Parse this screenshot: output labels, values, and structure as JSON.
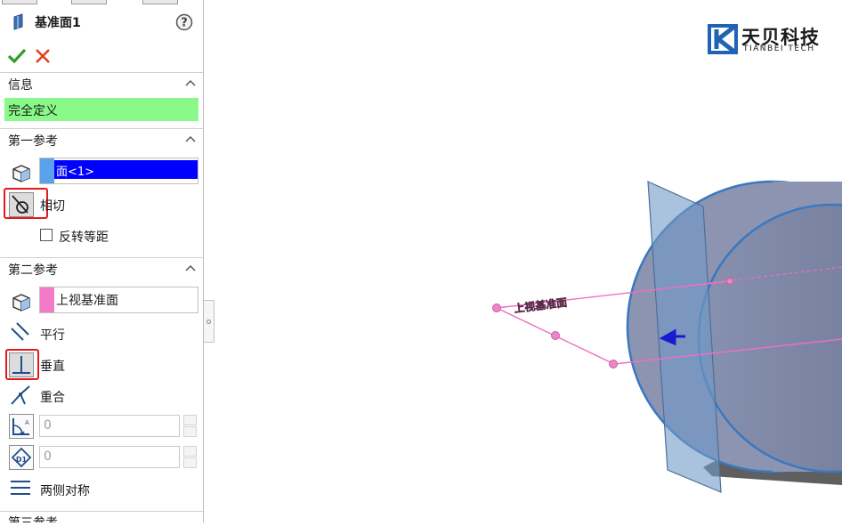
{
  "feature": {
    "title": "基准面1",
    "help_icon": "help-icon",
    "ok_icon": "check-icon",
    "cancel_icon": "cancel-x-icon"
  },
  "info": {
    "header": "信息",
    "status": "完全定义",
    "status_color": "#89fa89"
  },
  "ref1": {
    "header": "第一参考",
    "selection": "面<1>",
    "selection_bg": "#0000ff",
    "tangent_label": "相切",
    "flip_label": "反转等距"
  },
  "ref2": {
    "header": "第二参考",
    "selection": "上视基准面",
    "parallel_label": "平行",
    "perpendicular_label": "垂直",
    "coincident_label": "重合",
    "angle_value": "0",
    "distance_value": "0",
    "symmetric_label": "两侧对称"
  },
  "ref3": {
    "header": "第三参考"
  },
  "logo": {
    "cn": "天贝科技",
    "en": "TIANBEI TECH",
    "color": "#1e63b4"
  },
  "viewport": {
    "plane_label": "上视基准面"
  },
  "colors": {
    "accent_red": "#e8191b",
    "ok_green": "#2aa02a",
    "sketch_pink": "#f06ec0"
  }
}
